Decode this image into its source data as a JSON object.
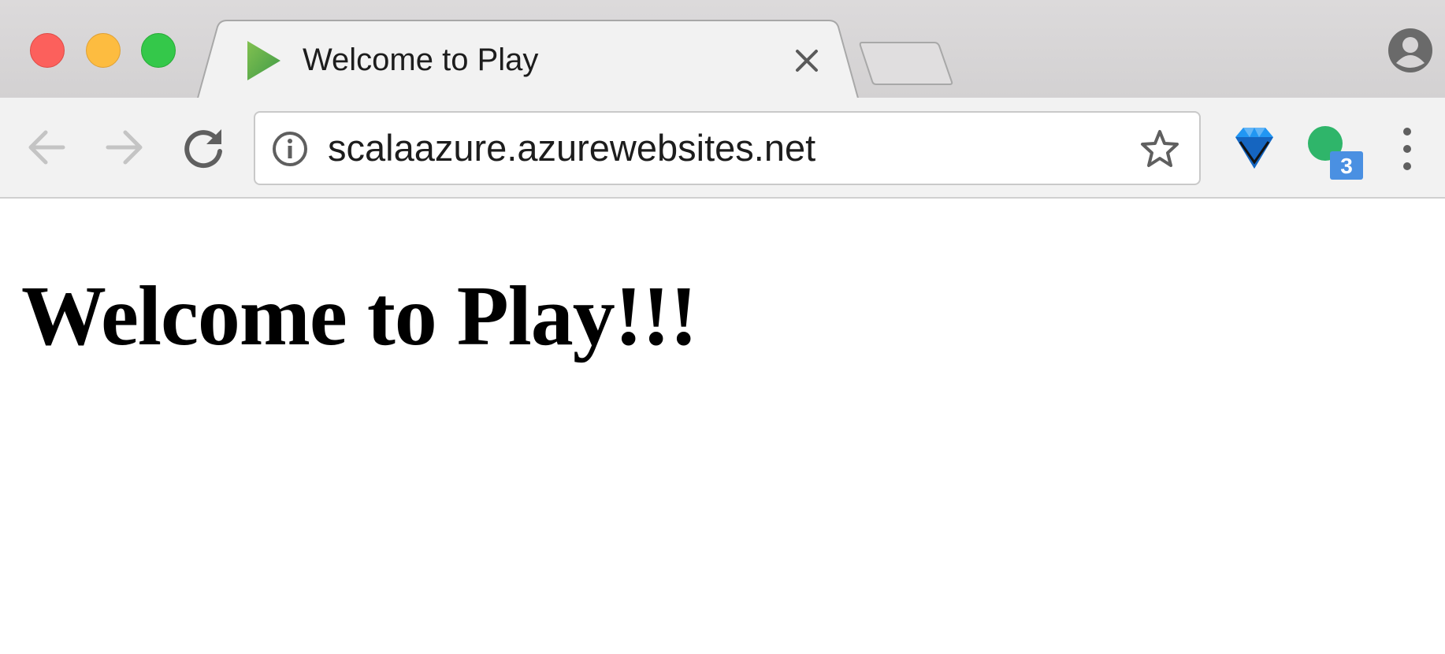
{
  "window": {
    "tab": {
      "title": "Welcome to Play",
      "favicon": "play-triangle-icon"
    },
    "controls": [
      "close",
      "minimize",
      "maximize"
    ]
  },
  "toolbar": {
    "url": "scalaazure.azurewebsites.net",
    "extensions": [
      {
        "icon": "diamond-extension-icon"
      },
      {
        "icon": "green-dot-extension-icon",
        "badge": "3"
      }
    ]
  },
  "page": {
    "heading": "Welcome to Play!!!"
  },
  "colors": {
    "close": "#fc605c",
    "minimize": "#fdbc40",
    "maximize": "#34c84a",
    "favicon_green": "#5fb04a",
    "badge_blue": "#4a90e2"
  }
}
